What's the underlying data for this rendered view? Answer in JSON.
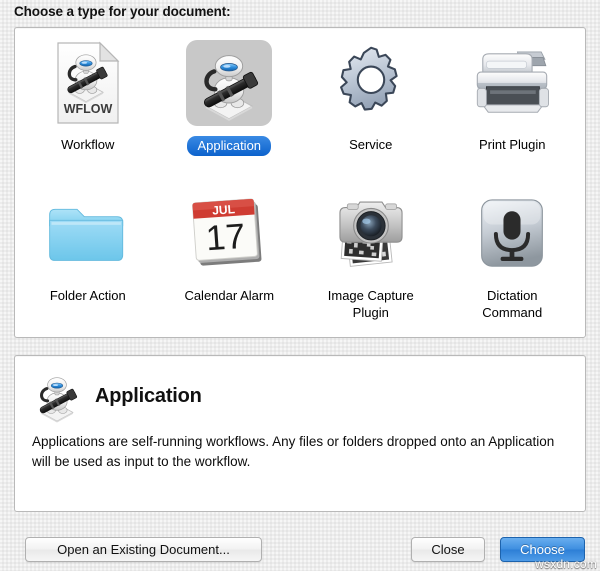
{
  "dialog": {
    "title": "Choose a type for your document:"
  },
  "document_types": [
    {
      "id": "workflow",
      "label": "Workflow",
      "icon": "workflow-document-icon",
      "selected": false
    },
    {
      "id": "application",
      "label": "Application",
      "icon": "application-robot-icon",
      "selected": true
    },
    {
      "id": "service",
      "label": "Service",
      "icon": "gear-icon",
      "selected": false
    },
    {
      "id": "print-plugin",
      "label": "Print Plugin",
      "icon": "printer-icon",
      "selected": false
    },
    {
      "id": "folder-action",
      "label": "Folder Action",
      "icon": "folder-icon",
      "selected": false
    },
    {
      "id": "calendar-alarm",
      "label": "Calendar Alarm",
      "icon": "calendar-icon",
      "selected": false
    },
    {
      "id": "image-capture",
      "label": "Image Capture\nPlugin",
      "icon": "camera-icon",
      "selected": false
    },
    {
      "id": "dictation",
      "label": "Dictation\nCommand",
      "icon": "microphone-icon",
      "selected": false
    }
  ],
  "description": {
    "icon": "application-robot-icon",
    "title": "Application",
    "body": "Applications are self-running workflows. Any files or folders dropped onto an Application will be used as input to the workflow."
  },
  "buttons": {
    "open_existing": "Open an Existing Document...",
    "close": "Close",
    "choose": "Choose"
  },
  "calendar_icon": {
    "month": "JUL",
    "day": "17"
  },
  "workflow_icon": {
    "badge_text": "WFLOW"
  },
  "watermark": "wsxdn.com",
  "colors": {
    "selection_blue": "#1a6fd4",
    "default_button_blue": "#3f8fe0",
    "selected_tile_gray": "#c8c8c8",
    "panel_background": "#ffffff",
    "window_background": "#ececec",
    "calendar_red": "#cf3c32",
    "folder_blue": "#86d3f2"
  }
}
